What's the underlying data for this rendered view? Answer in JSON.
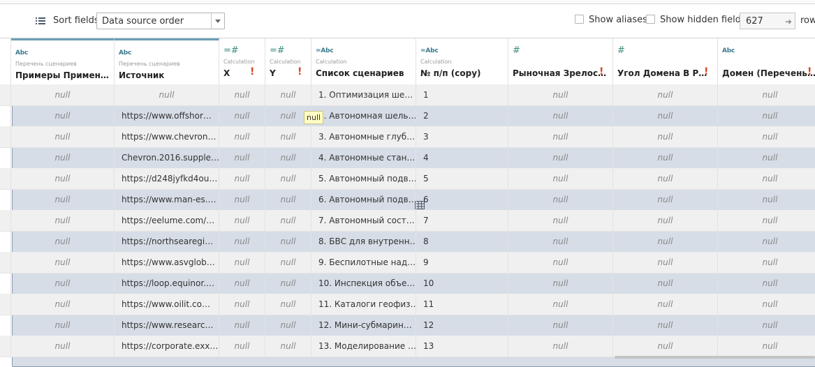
{
  "toolbar": {
    "sort_label": "Sort fields",
    "sort_value": "Data source order",
    "show_aliases": "Show aliases",
    "show_hidden": "Show hidden fields",
    "rows_value": "627",
    "rows_label": "rows"
  },
  "columns": [
    {
      "type": "Abc",
      "source": "Перечень сценариев",
      "name": "Примеры Примен…",
      "warn": ""
    },
    {
      "type": "Abc",
      "source": "Перечень сценариев",
      "name": "Источник",
      "warn": ""
    },
    {
      "type": "=#",
      "source": "Calculation",
      "name": "X",
      "warn": "!"
    },
    {
      "type": "=#",
      "source": "Calculation",
      "name": "Y",
      "warn": "!"
    },
    {
      "type": "=Abc",
      "source": "Calculation",
      "name": "Список сценариев",
      "warn": ""
    },
    {
      "type": "=Abc",
      "source": "Calculation",
      "name": "№ п/п (copy)",
      "warn": ""
    },
    {
      "type": "#",
      "source": "",
      "name": "Рыночная Зрелос…",
      "warn": "!"
    },
    {
      "type": "#",
      "source": "",
      "name": "Угол Домена В Р…",
      "warn": "!"
    },
    {
      "type": "Abc",
      "source": "",
      "name": "Домен (Перечень…",
      "warn": "!"
    }
  ],
  "rows": [
    [
      "null",
      "null",
      "null",
      "null",
      "1. Оптимизация ше…",
      "1",
      "null",
      "null",
      "null"
    ],
    [
      "null",
      "https://www.offshor…",
      "null",
      "null",
      "2. Автономная шель…",
      "2",
      "null",
      "null",
      "null"
    ],
    [
      "null",
      "https://www.chevron…",
      "null",
      "null",
      "3. Автономные глуб…",
      "3",
      "null",
      "null",
      "null"
    ],
    [
      "null",
      "Chevron.2016.supple…",
      "null",
      "null",
      "4. Автономные стан…",
      "4",
      "null",
      "null",
      "null"
    ],
    [
      "null",
      "https://d248jyfkd4ou…",
      "null",
      "null",
      "5. Автономный подв…",
      "5",
      "null",
      "null",
      "null"
    ],
    [
      "null",
      "https://www.man-es.…",
      "null",
      "null",
      "6. Автономный подв…",
      "6",
      "null",
      "null",
      "null"
    ],
    [
      "null",
      "https://eelume.com/…",
      "null",
      "null",
      "7. Автономный сост…",
      "7",
      "null",
      "null",
      "null"
    ],
    [
      "null",
      "https://northsearegi…",
      "null",
      "null",
      "8. БВС для внутренн…",
      "8",
      "null",
      "null",
      "null"
    ],
    [
      "null",
      "https://www.asvglob…",
      "null",
      "null",
      "9. Беспилотные над…",
      "9",
      "null",
      "null",
      "null"
    ],
    [
      "null",
      "https://loop.equinor.…",
      "null",
      "null",
      "10. Инспекция объе…",
      "10",
      "null",
      "null",
      "null"
    ],
    [
      "null",
      "https://www.oilit.co…",
      "null",
      "null",
      "11. Каталоги геофиз…",
      "11",
      "null",
      "null",
      "null"
    ],
    [
      "null",
      "https://www.researc…",
      "null",
      "null",
      "12. Мини-субмарин…",
      "12",
      "null",
      "null",
      "null"
    ],
    [
      "null",
      "https://corporate.exx…",
      "null",
      "null",
      "13. Моделирование …",
      "13",
      "null",
      "null",
      "null"
    ]
  ],
  "tooltip": "null"
}
